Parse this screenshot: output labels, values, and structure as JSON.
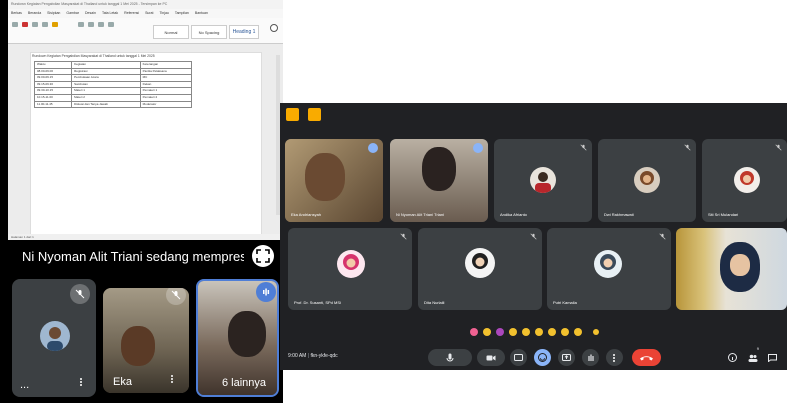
{
  "document": {
    "title_bar": "Rundown Kegiatan Pengabdian Masyarakat di Thailand untuk tanggal 1 Mei 2025 - Tersimpan ke PC",
    "menu": [
      "Berkas",
      "Beranda",
      "Sisipkan",
      "Gambar",
      "Desain",
      "Tata Letak",
      "Referensi",
      "Surat",
      "Tinjau",
      "Tampilan",
      "Bantuan"
    ],
    "styles": [
      "Normal",
      "No Spacing",
      "Heading 1"
    ],
    "heading": "Rundown Kegiatan Pengabdian Masyarakat di Thailand untuk tanggal 1 Mei 2025",
    "table": [
      [
        "Waktu",
        "Kegiatan",
        "Keterangan"
      ],
      [
        "08.00-09.00",
        "Registrasi",
        "Panitia Pelaksana"
      ],
      [
        "09.00-09.15",
        "Pembukaan Acara",
        "MC"
      ],
      [
        "09.15-09.30",
        "Sambutan",
        "Dekan"
      ],
      [
        "09.30-10.15",
        "Materi 1",
        "Pemateri 1"
      ],
      [
        "10.15-11.00",
        "Materi 2",
        "Pemateri 2"
      ],
      [
        "11.00-11.45",
        "Diskusi dan Tanya Jawab",
        "Moderator"
      ]
    ],
    "status": "Halaman 1 dari 1"
  },
  "presenting_banner": "Ni Nyoman Alit Triani sedang mempresentasikan",
  "mobile_tiles": [
    {
      "name": "..."
    },
    {
      "name": "Eka"
    },
    {
      "name": "6 lainnya"
    }
  ],
  "meet": {
    "participants": [
      {
        "name": "Eka Andriansyah"
      },
      {
        "name": "Ni Nyoman Alit Triani Triani"
      },
      {
        "name": "Andika Afrianto"
      },
      {
        "name": "Dwi Rakhmawati"
      },
      {
        "name": "Siti Sri Mulandari"
      },
      {
        "name": "Prof. Dr. Susanti, SPd MSi"
      },
      {
        "name": "Dita Nurlaili"
      },
      {
        "name": "Putri Kamalia"
      },
      {
        "name": ""
      }
    ],
    "time": "9:00 AM",
    "meeting_code": "fkn-ykfe-qdc",
    "participant_count": "9"
  },
  "colors": {
    "meet_bg": "#202124",
    "tile_bg": "#3c4043",
    "end_call": "#ea4335",
    "accent_blue": "#8ab4f8",
    "presenting_border": "#4f7ed6",
    "yellow_icon": "#f9ab00"
  }
}
